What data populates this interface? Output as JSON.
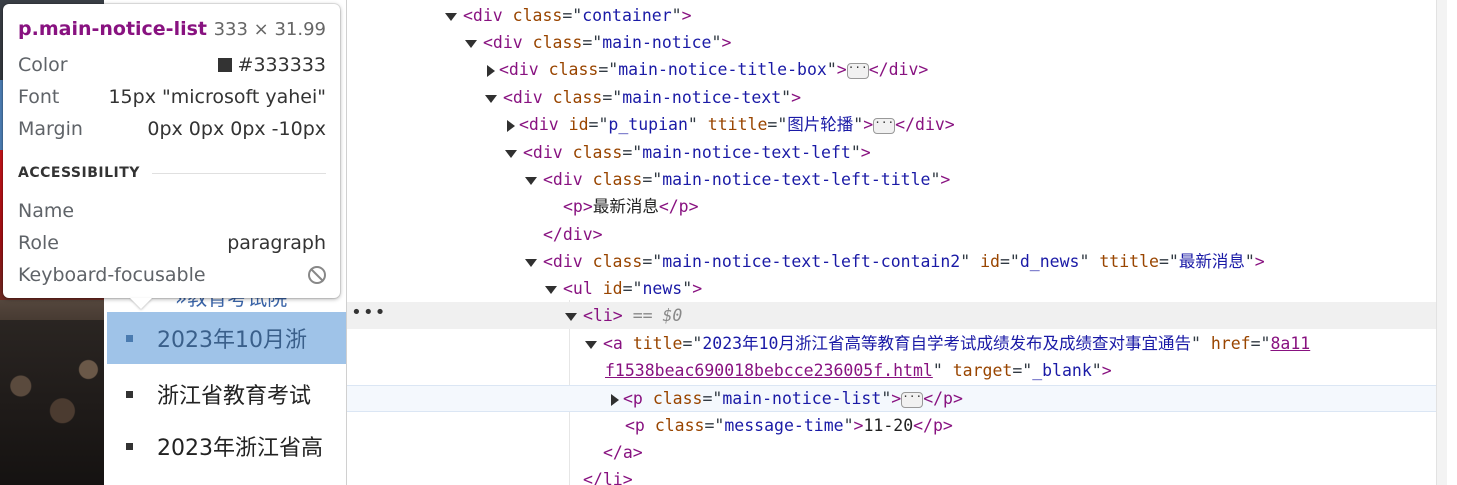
{
  "tooltip": {
    "selector": "p.main-notice-list",
    "size": "333 × 31.99",
    "color_label": "Color",
    "color_value": "#333333",
    "color_swatch": "#333333",
    "font_label": "Font",
    "font_value": "15px \"microsoft yahei\"",
    "margin_label": "Margin",
    "margin_value": "0px 0px 0px -10px",
    "section_title": "ACCESSIBILITY",
    "name_label": "Name",
    "name_value": "",
    "role_label": "Role",
    "role_value": "paragraph",
    "focus_label": "Keyboard-focusable",
    "focus_icon": "not-allowed-icon"
  },
  "page": {
    "partial_text": "»教育考试院",
    "news": [
      "2023年10月浙",
      "浙江省教育考试",
      "2023年浙江省高"
    ]
  },
  "dom": {
    "container_class": "container",
    "main_notice_class": "main-notice",
    "title_box_class": "main-notice-title-box",
    "text_class": "main-notice-text",
    "tupian_id": "p_tupian",
    "tupian_ttitle": "图片轮播",
    "left_class": "main-notice-text-left",
    "left_title_class": "main-notice-text-left-title",
    "left_title_text": "最新消息",
    "contain_class": "main-notice-text-left-contain2",
    "contain_id": "d_news",
    "contain_ttitle": "最新消息",
    "ul_id": "news",
    "li_marker": "== $0",
    "a_title": "2023年10月浙江省高等教育自学考试成绩发布及成绩查对事宜通告",
    "a_href_line1": "8a11",
    "a_href_line2": "f1538beac690018bebcce236005f.html",
    "a_target": "_blank",
    "p_list_class": "main-notice-list",
    "p_time_class": "message-time",
    "p_time_text": "11-20"
  }
}
